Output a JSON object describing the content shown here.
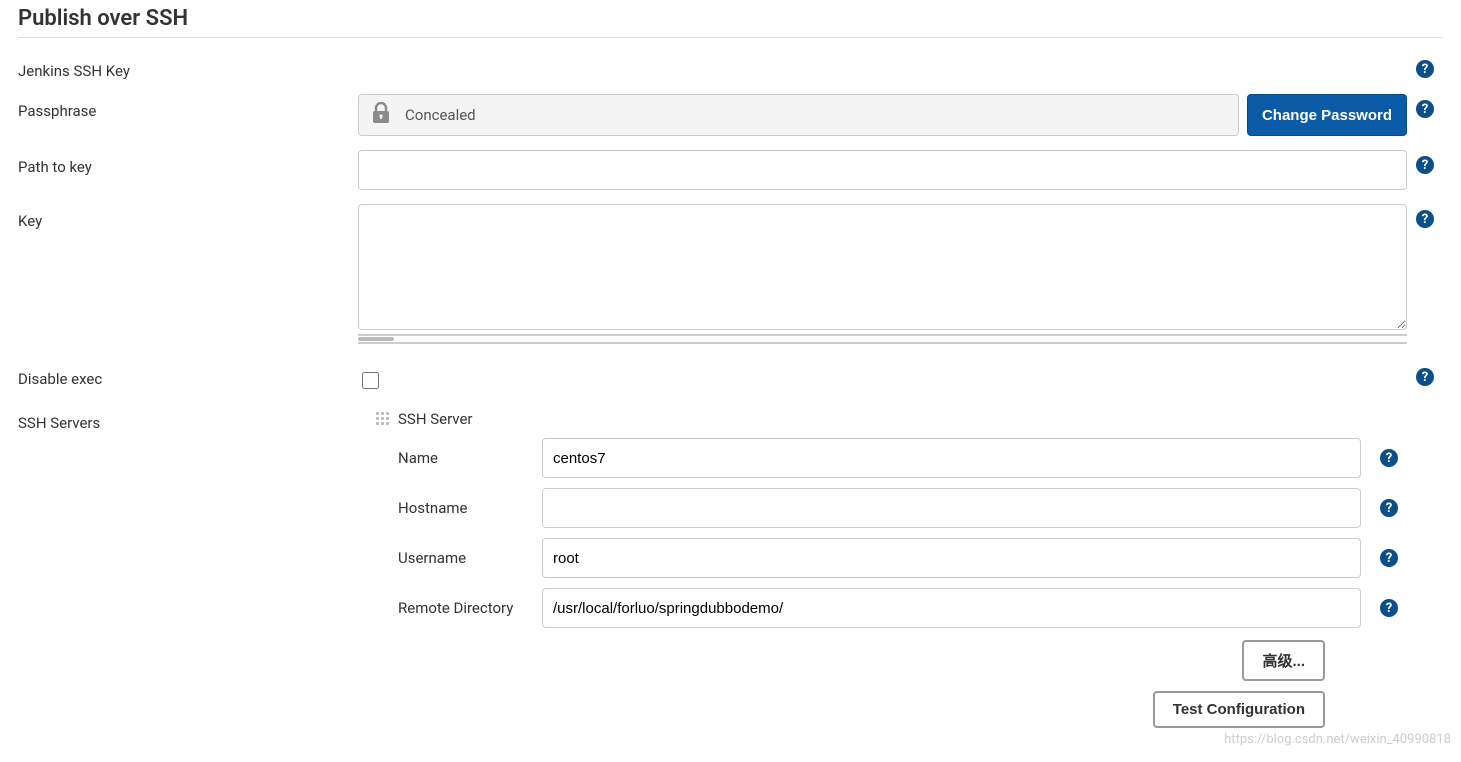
{
  "section": {
    "title": "Publish over SSH"
  },
  "ssh_key": {
    "heading": "Jenkins SSH Key",
    "passphrase_label": "Passphrase",
    "concealed_text": "Concealed",
    "change_password_label": "Change Password",
    "path_to_key_label": "Path to key",
    "path_to_key_value": "",
    "key_label": "Key",
    "key_value": "",
    "disable_exec_label": "Disable exec",
    "disable_exec_checked": false
  },
  "ssh_servers": {
    "heading": "SSH Servers",
    "server_block_title": "SSH Server",
    "name_label": "Name",
    "name_value": "centos7",
    "hostname_label": "Hostname",
    "hostname_value": "",
    "username_label": "Username",
    "username_value": "root",
    "remote_dir_label": "Remote Directory",
    "remote_dir_value": "/usr/local/forluo/springdubbodemo/",
    "advanced_btn": "高级...",
    "test_config_btn": "Test Configuration"
  },
  "watermark": "https://blog.csdn.net/weixin_40990818"
}
